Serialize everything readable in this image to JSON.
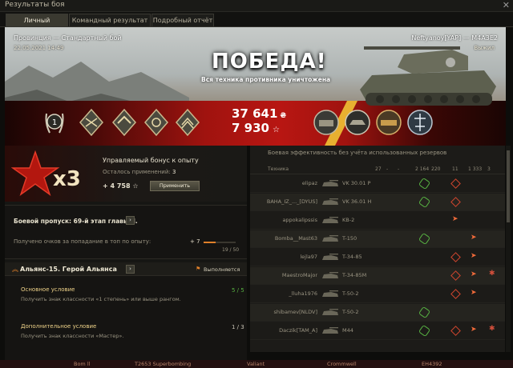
{
  "window": {
    "title": "Результаты боя",
    "close_glyph": "✕"
  },
  "tabs": [
    {
      "label": "Личный результат",
      "active": true
    },
    {
      "label": "Командный результат",
      "active": false
    },
    {
      "label": "Подробный отчёт",
      "active": false
    }
  ],
  "battle": {
    "map": "Провинция — Стандартный бой",
    "datetime": "22.05.2021 14:49",
    "player": "Neftyanoy[YAP] — M4A3E2",
    "status": "Выжил",
    "result": "ПОБЕДА!",
    "result_sub": "Вся техника противника уничтожена",
    "rank": "1"
  },
  "earnings": {
    "credits": "37 641",
    "credits_icon": "₴",
    "xp": "7 930",
    "xp_icon": "☆"
  },
  "bonus": {
    "title": "Управляемый бонус к опыту",
    "remaining_label": "Осталось применений:",
    "remaining_value": "3",
    "multiplier": "x3",
    "xp": "+ 4 758 ☆",
    "apply_label": "Применить"
  },
  "battlepass": {
    "title": "Боевой пропуск: 69-й этап главы II.",
    "arrow": "›",
    "desc": "Получено очков за попадание в топ по опыту:",
    "points": "+ 7",
    "progress": "19 / 50",
    "progress_fraction": 0.38
  },
  "mission": {
    "chevron": "︽",
    "title": "Альянс-15. Герой Альянса",
    "arrow": "›",
    "flag": "⚑",
    "status": "Выполняется",
    "main_title": "Основное условие",
    "main_desc": "Получить знак классности «1 степень» или выше рангом.",
    "main_val": "5 / 5",
    "extra_title": "Дополнительное условие",
    "extra_desc": "Получить знак классности «Мастер».",
    "extra_val": "1 / 3"
  },
  "efficiency": {
    "title": "Боевая эффективность без учёта использованных резервов",
    "col_tech": "Техника",
    "col_values": [
      "27",
      "-",
      "-",
      "2 164",
      "220",
      "11",
      "1 333",
      "3"
    ],
    "rows": [
      {
        "player": "elipaz",
        "tank": "VK 30.01 P"
      },
      {
        "player": "BAHA_IZ_..._[DYUS]",
        "tank": "VK 36.01 H"
      },
      {
        "player": "appokalipssis",
        "tank": "KB-2"
      },
      {
        "player": "Bomba__Mast63",
        "tank": "T-150"
      },
      {
        "player": "lejla97",
        "tank": "T-34-85"
      },
      {
        "player": "MaestroMajor",
        "tank": "T-34-85M"
      },
      {
        "player": "_lluha1976",
        "tank": "T-50-2"
      },
      {
        "player": "shibamev[NLDV]",
        "tank": "T-50-2"
      },
      {
        "player": "Daczik[TAM_A]",
        "tank": "M44"
      }
    ]
  },
  "bottom": [
    "Bom ll",
    "T2653 Superbombing",
    "Valiant",
    "Crommwell",
    "EH4392"
  ],
  "colors": {
    "accent_red": "#b81612",
    "accent_orange": "#e0802a",
    "success_green": "#57b142"
  }
}
